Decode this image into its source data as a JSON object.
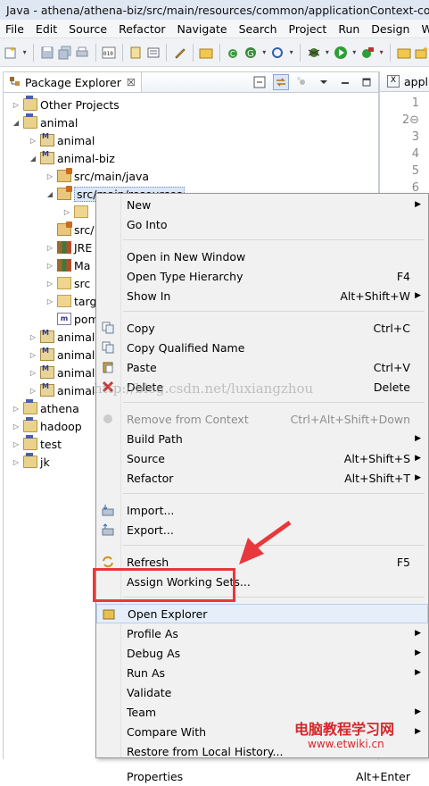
{
  "window": {
    "title": "Java - athena/athena-biz/src/main/resources/common/applicationContext-com"
  },
  "menubar": [
    "File",
    "Edit",
    "Source",
    "Refactor",
    "Navigate",
    "Search",
    "Project",
    "Run",
    "Design",
    "Wind"
  ],
  "package_explorer": {
    "tab_label": "Package Explorer",
    "close_glyph": "☒",
    "tree": [
      {
        "label": "Other Projects",
        "depth": 1,
        "twisty": "▷",
        "icon": "project"
      },
      {
        "label": "animal",
        "depth": 1,
        "twisty": "◢",
        "icon": "project"
      },
      {
        "label": "animal",
        "depth": 2,
        "twisty": "▷",
        "icon": "maven"
      },
      {
        "label": "animal-biz",
        "depth": 2,
        "twisty": "◢",
        "icon": "maven"
      },
      {
        "label": "src/main/java",
        "depth": 3,
        "twisty": "▷",
        "icon": "srcfolder"
      },
      {
        "label": "src/main/resources",
        "depth": 3,
        "twisty": "◢",
        "icon": "srcfolder",
        "selected": true
      },
      {
        "label": "",
        "depth": 4,
        "twisty": "▷",
        "icon": "folder"
      },
      {
        "label": "src/",
        "depth": 3,
        "twisty": "",
        "icon": "srcfolder"
      },
      {
        "label": "JRE",
        "depth": 3,
        "twisty": "▷",
        "icon": "jre"
      },
      {
        "label": "Ma",
        "depth": 3,
        "twisty": "▷",
        "icon": "jre"
      },
      {
        "label": "src",
        "depth": 3,
        "twisty": "▷",
        "icon": "folder"
      },
      {
        "label": "targ",
        "depth": 3,
        "twisty": "▷",
        "icon": "folder"
      },
      {
        "label": "pom",
        "depth": 3,
        "twisty": "",
        "icon": "pom"
      },
      {
        "label": "animal",
        "depth": 2,
        "twisty": "▷",
        "icon": "maven"
      },
      {
        "label": "animal",
        "depth": 2,
        "twisty": "▷",
        "icon": "maven"
      },
      {
        "label": "animal",
        "depth": 2,
        "twisty": "▷",
        "icon": "maven"
      },
      {
        "label": "animal",
        "depth": 2,
        "twisty": "▷",
        "icon": "maven"
      },
      {
        "label": "athena",
        "depth": 1,
        "twisty": "▷",
        "icon": "project"
      },
      {
        "label": "hadoop",
        "depth": 1,
        "twisty": "▷",
        "icon": "project"
      },
      {
        "label": "test",
        "depth": 1,
        "twisty": "▷",
        "icon": "project"
      },
      {
        "label": "jk",
        "depth": 1,
        "twisty": "▷",
        "icon": "project"
      }
    ]
  },
  "editor": {
    "tab_label": "appl",
    "line_numbers": [
      "1",
      "2⊖",
      "3",
      "4",
      "5",
      "6"
    ]
  },
  "context_menu": {
    "items": [
      {
        "label": "New",
        "shortcut": "",
        "submenu": true,
        "icon": ""
      },
      {
        "label": "Go Into",
        "shortcut": "",
        "submenu": false,
        "icon": ""
      },
      {
        "sep": true
      },
      {
        "label": "Open in New Window",
        "shortcut": "",
        "submenu": false,
        "icon": ""
      },
      {
        "label": "Open Type Hierarchy",
        "shortcut": "F4",
        "submenu": false,
        "icon": ""
      },
      {
        "label": "Show In",
        "shortcut": "Alt+Shift+W",
        "submenu": true,
        "icon": ""
      },
      {
        "sep": true
      },
      {
        "label": "Copy",
        "shortcut": "Ctrl+C",
        "submenu": false,
        "icon": "copy"
      },
      {
        "label": "Copy Qualified Name",
        "shortcut": "",
        "submenu": false,
        "icon": "copy"
      },
      {
        "label": "Paste",
        "shortcut": "Ctrl+V",
        "submenu": false,
        "icon": "paste"
      },
      {
        "label": "Delete",
        "shortcut": "Delete",
        "submenu": false,
        "icon": "delete"
      },
      {
        "sep": true
      },
      {
        "label": "Remove from Context",
        "shortcut": "Ctrl+Alt+Shift+Down",
        "submenu": false,
        "icon": "remove",
        "disabled": true
      },
      {
        "label": "Build Path",
        "shortcut": "",
        "submenu": true,
        "icon": ""
      },
      {
        "label": "Source",
        "shortcut": "Alt+Shift+S",
        "submenu": true,
        "icon": ""
      },
      {
        "label": "Refactor",
        "shortcut": "Alt+Shift+T",
        "submenu": true,
        "icon": ""
      },
      {
        "sep": true
      },
      {
        "label": "Import...",
        "shortcut": "",
        "submenu": false,
        "icon": "import"
      },
      {
        "label": "Export...",
        "shortcut": "",
        "submenu": false,
        "icon": "export"
      },
      {
        "sep": true
      },
      {
        "label": "Refresh",
        "shortcut": "F5",
        "submenu": false,
        "icon": "refresh"
      },
      {
        "label": "Assign Working Sets...",
        "shortcut": "",
        "submenu": false,
        "icon": ""
      },
      {
        "sep": true
      },
      {
        "label": "Open Explorer",
        "shortcut": "",
        "submenu": false,
        "icon": "explorer",
        "highlight": true
      },
      {
        "label": "Profile As",
        "shortcut": "",
        "submenu": true,
        "icon": ""
      },
      {
        "label": "Debug As",
        "shortcut": "",
        "submenu": true,
        "icon": ""
      },
      {
        "label": "Run As",
        "shortcut": "",
        "submenu": true,
        "icon": ""
      },
      {
        "label": "Validate",
        "shortcut": "",
        "submenu": false,
        "icon": ""
      },
      {
        "label": "Team",
        "shortcut": "",
        "submenu": true,
        "icon": ""
      },
      {
        "label": "Compare With",
        "shortcut": "",
        "submenu": true,
        "icon": ""
      },
      {
        "label": "Restore from Local History...",
        "shortcut": "",
        "submenu": false,
        "icon": ""
      },
      {
        "sep": true
      },
      {
        "label": "Properties",
        "shortcut": "Alt+Enter",
        "submenu": false,
        "icon": ""
      }
    ]
  },
  "watermarks": {
    "blog": "http://blog.csdn.net/luxiangzhou",
    "site_cn": "电脑教程学习网",
    "site_url": "www.etwiki.cn"
  },
  "colors": {
    "annotation_red": "#e8383c",
    "accent_blue": "#4a5fb0"
  }
}
